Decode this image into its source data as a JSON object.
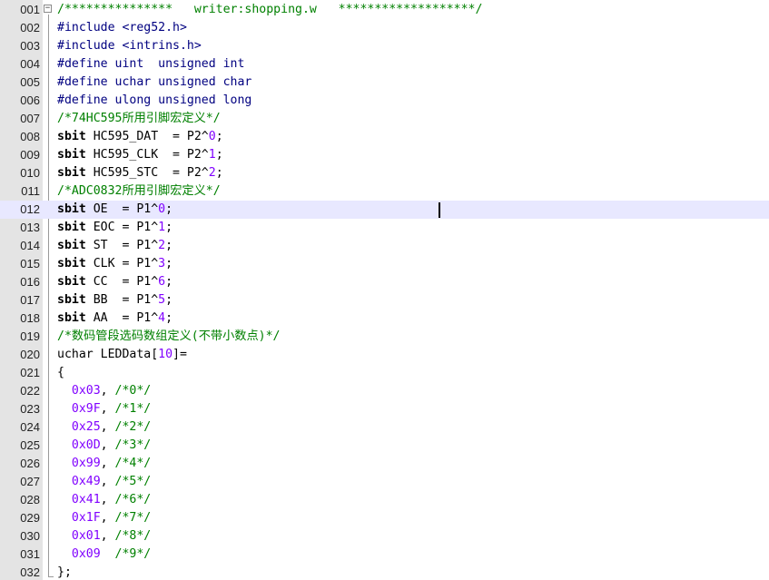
{
  "editor": {
    "fold_symbol": "−",
    "current_line": 12,
    "lines": [
      {
        "n": "001",
        "tokens": [
          {
            "t": "/***************   writer:shopping.w   *******************/",
            "c": "comment"
          }
        ]
      },
      {
        "n": "002",
        "tokens": [
          {
            "t": "#include <reg52.h>",
            "c": "pre"
          }
        ]
      },
      {
        "n": "003",
        "tokens": [
          {
            "t": "#include <intrins.h>",
            "c": "pre"
          }
        ]
      },
      {
        "n": "004",
        "tokens": [
          {
            "t": "#define uint  unsigned int",
            "c": "pre"
          }
        ]
      },
      {
        "n": "005",
        "tokens": [
          {
            "t": "#define uchar unsigned char",
            "c": "pre"
          }
        ]
      },
      {
        "n": "006",
        "tokens": [
          {
            "t": "#define ulong unsigned long",
            "c": "pre"
          }
        ]
      },
      {
        "n": "007",
        "tokens": [
          {
            "t": "/*74HC595所用引脚宏定义*/",
            "c": "comment"
          }
        ]
      },
      {
        "n": "008",
        "tokens": [
          {
            "t": "sbit",
            "c": "kw"
          },
          {
            "t": " HC595_DAT  = P2^",
            "c": "plain"
          },
          {
            "t": "0",
            "c": "number"
          },
          {
            "t": ";",
            "c": "plain"
          }
        ]
      },
      {
        "n": "009",
        "tokens": [
          {
            "t": "sbit",
            "c": "kw"
          },
          {
            "t": " HC595_CLK  = P2^",
            "c": "plain"
          },
          {
            "t": "1",
            "c": "number"
          },
          {
            "t": ";",
            "c": "plain"
          }
        ]
      },
      {
        "n": "010",
        "tokens": [
          {
            "t": "sbit",
            "c": "kw"
          },
          {
            "t": " HC595_STC  = P2^",
            "c": "plain"
          },
          {
            "t": "2",
            "c": "number"
          },
          {
            "t": ";",
            "c": "plain"
          }
        ]
      },
      {
        "n": "011",
        "tokens": [
          {
            "t": "/*ADC0832所用引脚宏定义*/",
            "c": "comment"
          }
        ]
      },
      {
        "n": "012",
        "tokens": [
          {
            "t": "sbit",
            "c": "kw"
          },
          {
            "t": " OE  = P1^",
            "c": "plain"
          },
          {
            "t": "0",
            "c": "number"
          },
          {
            "t": ";",
            "c": "plain"
          }
        ]
      },
      {
        "n": "013",
        "tokens": [
          {
            "t": "sbit",
            "c": "kw"
          },
          {
            "t": " EOC = P1^",
            "c": "plain"
          },
          {
            "t": "1",
            "c": "number"
          },
          {
            "t": ";",
            "c": "plain"
          }
        ]
      },
      {
        "n": "014",
        "tokens": [
          {
            "t": "sbit",
            "c": "kw"
          },
          {
            "t": " ST  = P1^",
            "c": "plain"
          },
          {
            "t": "2",
            "c": "number"
          },
          {
            "t": ";",
            "c": "plain"
          }
        ]
      },
      {
        "n": "015",
        "tokens": [
          {
            "t": "sbit",
            "c": "kw"
          },
          {
            "t": " CLK = P1^",
            "c": "plain"
          },
          {
            "t": "3",
            "c": "number"
          },
          {
            "t": ";",
            "c": "plain"
          }
        ]
      },
      {
        "n": "016",
        "tokens": [
          {
            "t": "sbit",
            "c": "kw"
          },
          {
            "t": " CC  = P1^",
            "c": "plain"
          },
          {
            "t": "6",
            "c": "number"
          },
          {
            "t": ";",
            "c": "plain"
          }
        ]
      },
      {
        "n": "017",
        "tokens": [
          {
            "t": "sbit",
            "c": "kw"
          },
          {
            "t": " BB  = P1^",
            "c": "plain"
          },
          {
            "t": "5",
            "c": "number"
          },
          {
            "t": ";",
            "c": "plain"
          }
        ]
      },
      {
        "n": "018",
        "tokens": [
          {
            "t": "sbit",
            "c": "kw"
          },
          {
            "t": " AA  = P1^",
            "c": "plain"
          },
          {
            "t": "4",
            "c": "number"
          },
          {
            "t": ";",
            "c": "plain"
          }
        ]
      },
      {
        "n": "019",
        "tokens": [
          {
            "t": "/*数码管段选码数组定义(不带小数点)*/",
            "c": "comment"
          }
        ]
      },
      {
        "n": "020",
        "tokens": [
          {
            "t": "uchar LEDData[",
            "c": "plain"
          },
          {
            "t": "10",
            "c": "number"
          },
          {
            "t": "]=",
            "c": "plain"
          }
        ]
      },
      {
        "n": "021",
        "tokens": [
          {
            "t": "{",
            "c": "plain"
          }
        ]
      },
      {
        "n": "022",
        "tokens": [
          {
            "t": "  ",
            "c": "plain"
          },
          {
            "t": "0x03",
            "c": "number"
          },
          {
            "t": ", ",
            "c": "plain"
          },
          {
            "t": "/*0*/",
            "c": "comment"
          }
        ]
      },
      {
        "n": "023",
        "tokens": [
          {
            "t": "  ",
            "c": "plain"
          },
          {
            "t": "0x9F",
            "c": "number"
          },
          {
            "t": ", ",
            "c": "plain"
          },
          {
            "t": "/*1*/",
            "c": "comment"
          }
        ]
      },
      {
        "n": "024",
        "tokens": [
          {
            "t": "  ",
            "c": "plain"
          },
          {
            "t": "0x25",
            "c": "number"
          },
          {
            "t": ", ",
            "c": "plain"
          },
          {
            "t": "/*2*/",
            "c": "comment"
          }
        ]
      },
      {
        "n": "025",
        "tokens": [
          {
            "t": "  ",
            "c": "plain"
          },
          {
            "t": "0x0D",
            "c": "number"
          },
          {
            "t": ", ",
            "c": "plain"
          },
          {
            "t": "/*3*/",
            "c": "comment"
          }
        ]
      },
      {
        "n": "026",
        "tokens": [
          {
            "t": "  ",
            "c": "plain"
          },
          {
            "t": "0x99",
            "c": "number"
          },
          {
            "t": ", ",
            "c": "plain"
          },
          {
            "t": "/*4*/",
            "c": "comment"
          }
        ]
      },
      {
        "n": "027",
        "tokens": [
          {
            "t": "  ",
            "c": "plain"
          },
          {
            "t": "0x49",
            "c": "number"
          },
          {
            "t": ", ",
            "c": "plain"
          },
          {
            "t": "/*5*/",
            "c": "comment"
          }
        ]
      },
      {
        "n": "028",
        "tokens": [
          {
            "t": "  ",
            "c": "plain"
          },
          {
            "t": "0x41",
            "c": "number"
          },
          {
            "t": ", ",
            "c": "plain"
          },
          {
            "t": "/*6*/",
            "c": "comment"
          }
        ]
      },
      {
        "n": "029",
        "tokens": [
          {
            "t": "  ",
            "c": "plain"
          },
          {
            "t": "0x1F",
            "c": "number"
          },
          {
            "t": ", ",
            "c": "plain"
          },
          {
            "t": "/*7*/",
            "c": "comment"
          }
        ]
      },
      {
        "n": "030",
        "tokens": [
          {
            "t": "  ",
            "c": "plain"
          },
          {
            "t": "0x01",
            "c": "number"
          },
          {
            "t": ", ",
            "c": "plain"
          },
          {
            "t": "/*8*/",
            "c": "comment"
          }
        ]
      },
      {
        "n": "031",
        "tokens": [
          {
            "t": "  ",
            "c": "plain"
          },
          {
            "t": "0x09",
            "c": "number"
          },
          {
            "t": "  ",
            "c": "plain"
          },
          {
            "t": "/*9*/",
            "c": "comment"
          }
        ]
      },
      {
        "n": "032",
        "tokens": [
          {
            "t": "};",
            "c": "plain"
          }
        ]
      }
    ]
  },
  "colors": {
    "preprocessor": "#000080",
    "keyword": "#000000",
    "comment": "#008000",
    "number": "#8000ff",
    "current_line_bg": "#e8e8ff",
    "gutter_bg": "#e4e4e4"
  }
}
